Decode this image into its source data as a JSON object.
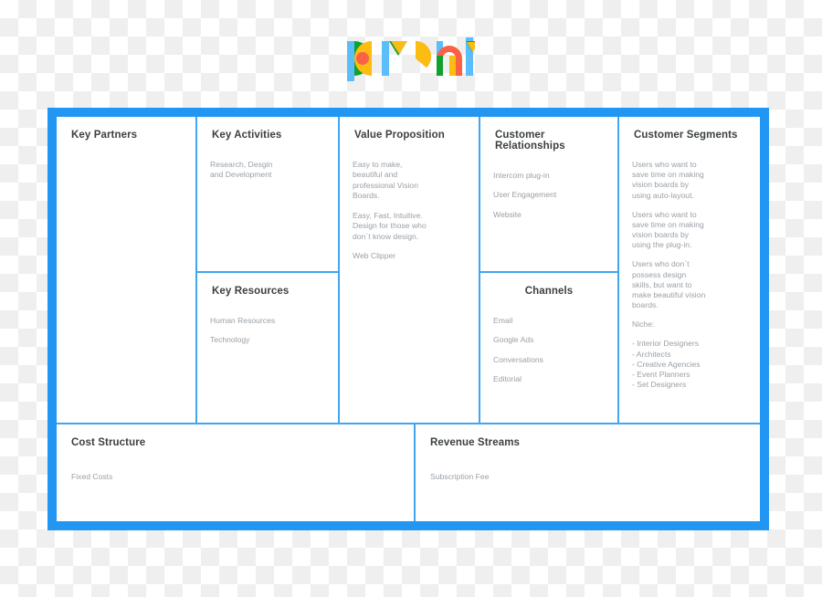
{
  "logo": {
    "name": "prsnl-logo",
    "wordmark": "prsnl",
    "colors": {
      "blue": "#5bbdf9",
      "green": "#14a02e",
      "yellow": "#fdbc12",
      "orange": "#fb6145",
      "red_orange": "#fc6145"
    }
  },
  "canvas": {
    "name": "business-model-canvas",
    "frame_color": "#2196f3",
    "divider_color": "#41a5f0",
    "title_color": "#3c4043",
    "text_color": "#9aa0a6",
    "blocks": [
      {
        "id": "key-partners",
        "title": "Key Partners",
        "align": "left",
        "entries": []
      },
      {
        "id": "key-activities",
        "title": "Key Activities",
        "align": "left",
        "entries": [
          "Research, Desgin\nand  Development"
        ]
      },
      {
        "id": "key-resources",
        "title": "Key Resources",
        "align": "left",
        "entries": [
          "Human Resources",
          "Technology"
        ]
      },
      {
        "id": "value-proposition",
        "title": "Value Proposition",
        "align": "left",
        "entries": [
          "Easy to make,\nbeautiful and\nprofessional Vision\nBoards.",
          "Easy, Fast, Intuitive.\nDesign for those who\ndon`t know design.",
          "Web Clipper"
        ]
      },
      {
        "id": "customer-relationships",
        "title": "Customer Relationships",
        "align": "left",
        "entries": [
          "Intercom plug-in",
          "User Engagement",
          "Website"
        ]
      },
      {
        "id": "channels",
        "title": "Channels",
        "align": "center",
        "entries": [
          "Email",
          "Google Ads",
          "Conversations",
          "Editorial"
        ]
      },
      {
        "id": "customer-segments",
        "title": "Customer Segments",
        "align": "left",
        "entries": [
          "Users who want to\nsave time on making\nvision boards by\nusing auto-layout.",
          "Users who want to\nsave time on making\nvision boards by\nusing the plug-in.",
          "Users who don`t\npossess design\nskills, but want to\nmake beautiful vision\nboards.",
          "Niche:",
          "- Interior Designers\n- Architects\n- Creative Agencies\n- Event Planners\n- Set Designers"
        ]
      },
      {
        "id": "cost-structure",
        "title": "Cost Structure",
        "align": "left",
        "entries": [
          "Fixed Costs"
        ]
      },
      {
        "id": "revenue-streams",
        "title": "Revenue Streams",
        "align": "left",
        "entries": [
          "Subscription Fee"
        ]
      }
    ]
  }
}
